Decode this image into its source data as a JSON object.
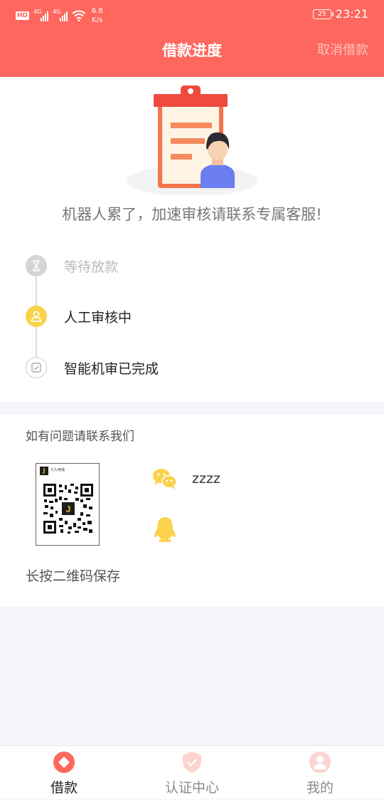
{
  "status_bar": {
    "hd": "HD",
    "signal_1": "4G",
    "signal_2": "4G",
    "net_speed": "6.8",
    "net_unit": "K/s",
    "battery": "25",
    "time": "23:21"
  },
  "header": {
    "title": "借款进度",
    "cancel": "取消借款",
    "bg_color": "#fe675e"
  },
  "notice": "机器人累了，加速审核请联系专属客服!",
  "timeline": [
    {
      "label": "等待放款",
      "icon": "hourglass-icon",
      "state": "pending"
    },
    {
      "label": "人工审核中",
      "icon": "person-icon",
      "state": "current"
    },
    {
      "label": "智能机审已完成",
      "icon": "check-icon",
      "state": "done"
    }
  ],
  "contact": {
    "title": "如有问题请联系我们",
    "qr_logo": "J",
    "qr_caption": "久久用钱",
    "wechat_id": "zzzz",
    "save_hint": "长按二维码保存"
  },
  "nav": [
    {
      "label": "借款",
      "icon": "loan-icon",
      "active": true
    },
    {
      "label": "认证中心",
      "icon": "shield-icon",
      "active": false
    },
    {
      "label": "我的",
      "icon": "profile-icon",
      "active": false
    }
  ],
  "colors": {
    "accent": "#fe675e",
    "highlight": "#fbd24c"
  }
}
